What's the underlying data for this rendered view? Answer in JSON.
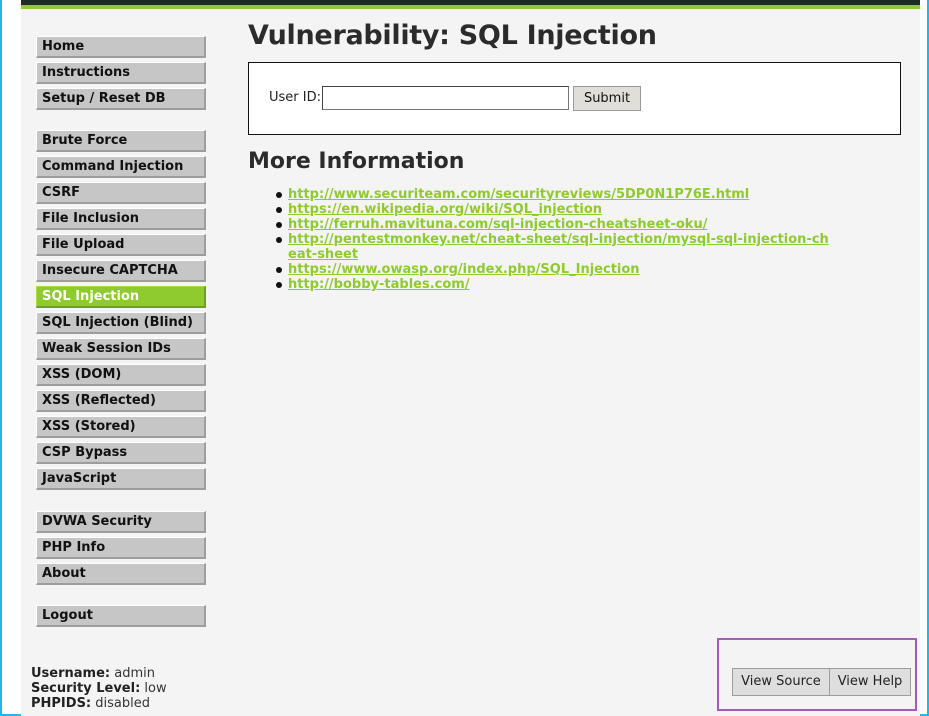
{
  "menu": {
    "group1": [
      "Home",
      "Instructions",
      "Setup / Reset DB"
    ],
    "group2": [
      "Brute Force",
      "Command Injection",
      "CSRF",
      "File Inclusion",
      "File Upload",
      "Insecure CAPTCHA",
      "SQL Injection",
      "SQL Injection (Blind)",
      "Weak Session IDs",
      "XSS (DOM)",
      "XSS (Reflected)",
      "XSS (Stored)",
      "CSP Bypass",
      "JavaScript"
    ],
    "group3": [
      "DVWA Security",
      "PHP Info",
      "About"
    ],
    "group4": [
      "Logout"
    ],
    "active": "SQL Injection"
  },
  "main": {
    "title": "Vulnerability: SQL Injection",
    "userid_label": "User ID:",
    "userid_value": "",
    "submit_label": "Submit",
    "more_info_heading": "More Information",
    "links": [
      "http://www.securiteam.com/securityreviews/5DP0N1P76E.html",
      "https://en.wikipedia.org/wiki/SQL_injection",
      "http://ferruh.mavituna.com/sql-injection-cheatsheet-oku/",
      "http://pentestmonkey.net/cheat-sheet/sql-injection/mysql-sql-injection-cheat-sheet",
      "https://www.owasp.org/index.php/SQL_Injection",
      "http://bobby-tables.com/"
    ]
  },
  "user_info": {
    "username_label": "Username:",
    "username": "admin",
    "security_label": "Security Level:",
    "security": "low",
    "phpids_label": "PHPIDS:",
    "phpids": "disabled"
  },
  "help": {
    "view_source": "View Source",
    "view_help": "View Help"
  },
  "colors": {
    "accent_green": "#8fca2e",
    "frame_cyan": "#2bb3e6",
    "highlight_purple": "#a55db3"
  }
}
